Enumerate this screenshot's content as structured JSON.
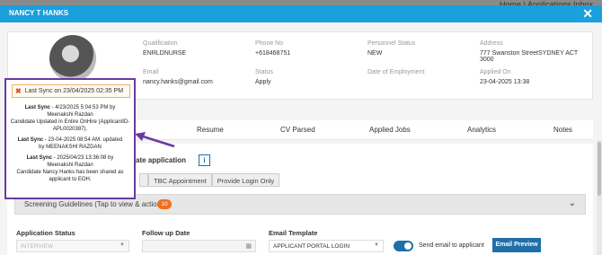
{
  "background": {
    "breadcrumb": "Home \\ Applications Inbox"
  },
  "modal": {
    "title": "NANCY T HANKS",
    "close_icon": "close-icon"
  },
  "profile": {
    "qualification_label": "Qualification",
    "qualification": "ENRLDNURSE",
    "phone_label": "Phone No",
    "phone": "+618468751",
    "personnel_status_label": "Personnel Status",
    "personnel_status": "NEW",
    "address_label": "Address",
    "address": "777 Swanston StreetSYDNEY ACT 3000",
    "email_label": "Email",
    "email": "nancy.hanks@gmail.com",
    "status_label": "Status",
    "status": "Apply",
    "employment_date_label": "Date of Employment",
    "employment_date": "",
    "applied_on_label": "Applied On",
    "applied_on": "23-04-2025 13:38"
  },
  "sync": {
    "button_label": "Last Sync on 23/04/2025 02:35 PM",
    "icon": "sync-icon",
    "entries": [
      {
        "title": "Last Sync",
        "line1": " - 4/23/2025 5:04:53 PM by",
        "line2": "Meenakshi Razdan",
        "detail": "Candidate Updated in Entire OnHire (ApplicantID- APL0020387)."
      },
      {
        "title": "Last Sync",
        "line1": " - 23-04-2025 08:54 AM. updated",
        "line2": "by MEENAKSHI RAZDAN",
        "detail": ""
      },
      {
        "title": "Last Sync",
        "line1": " - 2025/04/23 13:36:08 by",
        "line2": "Meenakshi Razdan",
        "detail": "Candidate Nancy Hanks has been shared as applicant to EOH."
      }
    ]
  },
  "tabs": [
    {
      "label": "e"
    },
    {
      "label": "Resume"
    },
    {
      "label": "CV Parsed"
    },
    {
      "label": "Applied Jobs"
    },
    {
      "label": "Analytics"
    },
    {
      "label": "Notes"
    }
  ],
  "panel": {
    "section_title": "ate application",
    "info_label": "i",
    "buttons": [
      "",
      "TBC Appointment",
      "Provide Login Only"
    ],
    "screening_label": "Screening Guidelines (Tap to view & action)",
    "screening_count": "10",
    "application_status_label": "Application Status",
    "application_status_value": "INTERVIEW",
    "follow_up_label": "Follow up Date",
    "email_template_label": "Email Template",
    "email_template_value": "APPLICANT PORTAL LOGIN",
    "send_email_label": "Send email to applicant",
    "email_preview_label": "Email Preview"
  }
}
